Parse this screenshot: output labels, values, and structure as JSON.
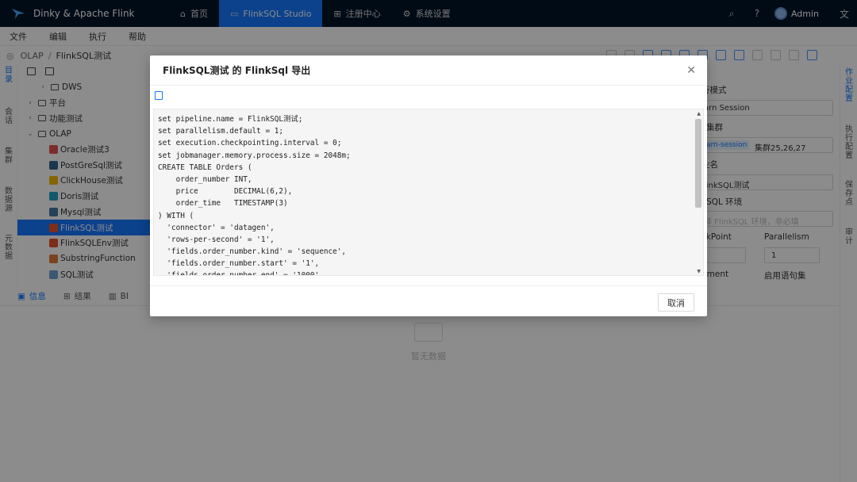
{
  "app": {
    "name": "Dinky & Apache Flink"
  },
  "nav": {
    "items": [
      {
        "label": "首页",
        "icon": "home-icon"
      },
      {
        "label": "FlinkSQL Studio",
        "icon": "code-icon"
      },
      {
        "label": "注册中心",
        "icon": "grid-icon"
      },
      {
        "label": "系统设置",
        "icon": "gear-icon"
      }
    ],
    "active_index": 1,
    "user": "Admin"
  },
  "menu": [
    "文件",
    "编辑",
    "执行",
    "帮助"
  ],
  "breadcrumb": {
    "parent": "OLAP",
    "current": "FlinkSQL测试",
    "separator": "/"
  },
  "left_rail": {
    "tabs": [
      "目录",
      "会话",
      "集群",
      "数据源",
      "元数据"
    ]
  },
  "tree": {
    "rows": [
      {
        "label": "DWS",
        "kind": "folder",
        "arrow": "›",
        "indent": 1
      },
      {
        "label": "平台",
        "kind": "folder",
        "arrow": "›",
        "indent": 0
      },
      {
        "label": "功能测试",
        "kind": "folder",
        "arrow": "›",
        "indent": 0
      },
      {
        "label": "OLAP",
        "kind": "folder-open",
        "arrow": "⌄",
        "indent": 0
      },
      {
        "label": "Oracle测试3",
        "kind": "file",
        "color": "#e05252",
        "indent": 2
      },
      {
        "label": "PostGreSql测试",
        "kind": "file",
        "color": "#336791",
        "indent": 2
      },
      {
        "label": "ClickHouse测试",
        "kind": "file",
        "color": "#f2b90c",
        "indent": 2
      },
      {
        "label": "Doris测试",
        "kind": "file",
        "color": "#21a0c7",
        "indent": 2
      },
      {
        "label": "Mysql测试",
        "kind": "file",
        "color": "#4479a1",
        "indent": 2
      },
      {
        "label": "FlinkSQL测试",
        "kind": "file",
        "color": "#e6522c",
        "indent": 2,
        "selected": true
      },
      {
        "label": "FlinkSQLEnv测试",
        "kind": "file",
        "color": "#e6522c",
        "indent": 2
      },
      {
        "label": "SubstringFunction",
        "kind": "file",
        "color": "#e07b39",
        "indent": 2
      },
      {
        "label": "SQL测试",
        "kind": "file",
        "color": "#6d9fd8",
        "indent": 2
      }
    ]
  },
  "config": {
    "mode_label": "行模式",
    "mode_value": "arn Session",
    "cluster_label": "k集群",
    "cluster_tag": "arn-session",
    "cluster_value": "集群25,26,27",
    "name_label": "业名",
    "name_value": "linkSQL测试",
    "env_label": "kSQL 环境",
    "env_placeholder": "择 FlinkSQL 环境，非必填",
    "checkpoint_label": "ckPoint",
    "parallelism_label": "Parallelism",
    "parallelism_value": "1",
    "fragment_label": "gment",
    "statement_set_label": "启用语句集"
  },
  "right_rail": {
    "tabs": [
      "作业配置",
      "执行配置",
      "保存点",
      "审计"
    ]
  },
  "bottom": {
    "tabs": [
      "信息",
      "结果",
      "BI"
    ],
    "empty_text": "暂无数据"
  },
  "modal": {
    "title": "FlinkSQL测试 的 FlinkSql 导出",
    "cancel_label": "取消",
    "code_lines": [
      "set pipeline.name = FlinkSQL测试;",
      "set parallelism.default = 1;",
      "set execution.checkpointing.interval = 0;",
      "set jobmanager.memory.process.size = 2048m;",
      "CREATE TABLE Orders (",
      "    order_number INT,",
      "    price        DECIMAL(6,2),",
      "    order_time   TIMESTAMP(3)",
      ") WITH (",
      "  'connector' = 'datagen',",
      "  'rows-per-second' = '1',",
      "  'fields.order_number.kind' = 'sequence',",
      "  'fields.order_number.start' = '1',",
      "  'fields.order_number.end' = '1000'"
    ]
  },
  "colors": {
    "primary": "#1677ff",
    "header_bg": "#001529"
  }
}
